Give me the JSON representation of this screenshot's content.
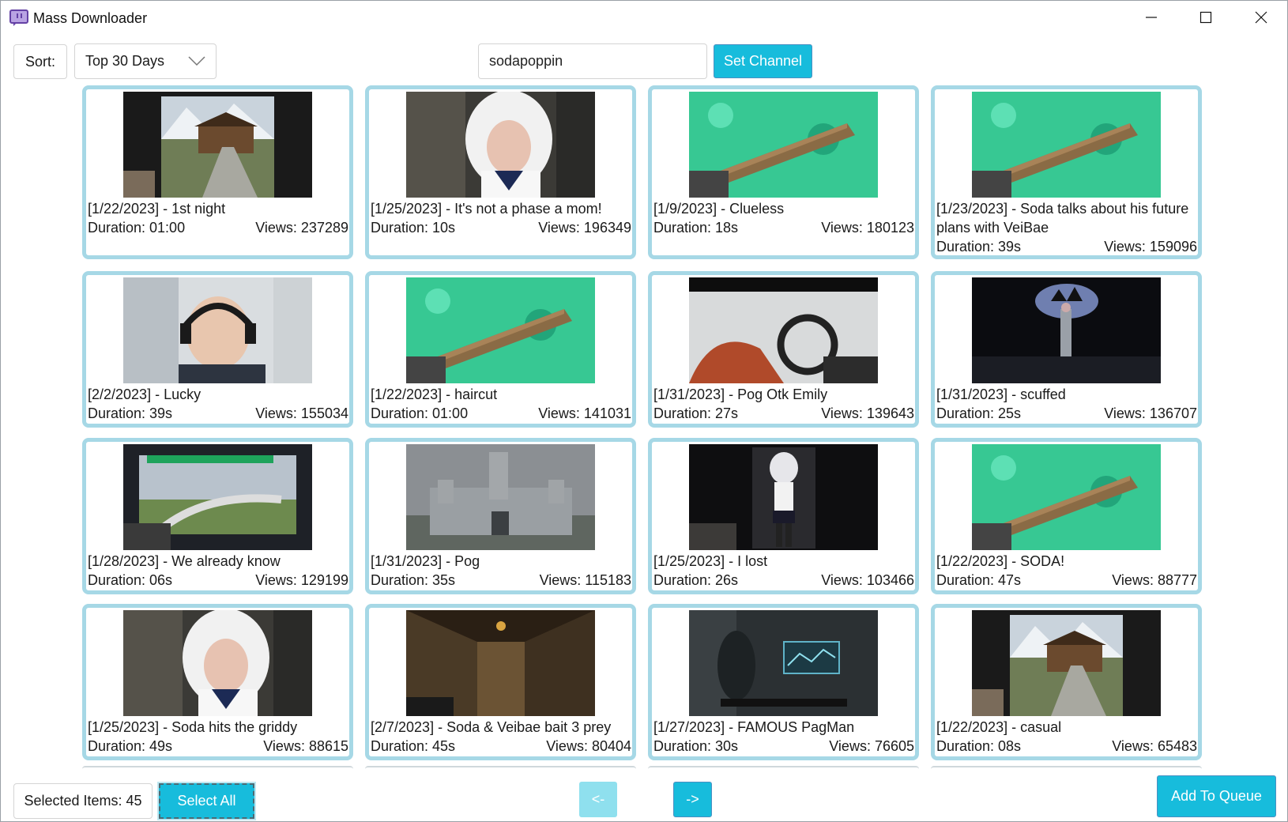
{
  "window": {
    "title": "Mass Downloader",
    "accent_color": "#17bcdc",
    "card_border_color": "#a6d8e6",
    "icon": "twitch-logo-icon"
  },
  "toolbar": {
    "sort_label": "Sort:",
    "sort_value": "Top 30 Days",
    "channel_value": "sodapoppin",
    "set_channel_label": "Set Channel"
  },
  "clips": [
    {
      "title": "[1/22/2023] - 1st night",
      "duration": "Duration: 01:00",
      "views": "Views: 237289",
      "thumb": "mountain-chalet"
    },
    {
      "title": "[1/25/2023] - It's not a phase a mom!",
      "duration": "Duration: 10s",
      "views": "Views: 196349",
      "thumb": "cosplay-streamer"
    },
    {
      "title": "[1/9/2023] - Clueless",
      "duration": "Duration: 18s",
      "views": "Views: 180123",
      "thumb": "water-dock"
    },
    {
      "title": "[1/23/2023] - Soda talks about his future plans with VeiBae",
      "duration": "Duration: 39s",
      "views": "Views: 159096",
      "thumb": "water-dock"
    },
    {
      "title": "[2/2/2023] - Lucky",
      "duration": "Duration: 39s",
      "views": "Views: 155034",
      "thumb": "headset-streamer"
    },
    {
      "title": "[1/22/2023] - haircut",
      "duration": "Duration: 01:00",
      "views": "Views: 141031",
      "thumb": "water-dock"
    },
    {
      "title": "[1/31/2023] - Pog Otk Emily",
      "duration": "Duration: 27s",
      "views": "Views: 139643",
      "thumb": "car-interior"
    },
    {
      "title": "[1/31/2023] - scuffed",
      "duration": "Duration: 25s",
      "views": "Views: 136707",
      "thumb": "dark-stage"
    },
    {
      "title": "[1/28/2023] - We already know",
      "duration": "Duration: 06s",
      "views": "Views: 129199",
      "thumb": "racing-game"
    },
    {
      "title": "[1/31/2023] - Pog",
      "duration": "Duration: 35s",
      "views": "Views: 115183",
      "thumb": "castle"
    },
    {
      "title": "[1/25/2023] - I lost",
      "duration": "Duration: 26s",
      "views": "Views: 103466",
      "thumb": "anime-avatar"
    },
    {
      "title": "[1/22/2023] - SODA!",
      "duration": "Duration: 47s",
      "views": "Views: 88777",
      "thumb": "water-dock"
    },
    {
      "title": "[1/25/2023] - Soda hits the griddy",
      "duration": "Duration: 49s",
      "views": "Views: 88615",
      "thumb": "cosplay-streamer"
    },
    {
      "title": "[2/7/2023] - Soda & Veibae bait 3 prey",
      "duration": "Duration: 45s",
      "views": "Views: 80404",
      "thumb": "dungeon"
    },
    {
      "title": "[1/27/2023] - FAMOUS PagMan",
      "duration": "Duration: 30s",
      "views": "Views: 76605",
      "thumb": "scifi-game"
    },
    {
      "title": "[1/22/2023] - casual",
      "duration": "Duration: 08s",
      "views": "Views: 65483",
      "thumb": "mountain-chalet"
    }
  ],
  "bottom": {
    "selected_label": "Selected Items: 45",
    "select_all_label": "Select All",
    "prev_label": "<-",
    "next_label": "->",
    "add_queue_label": "Add To Queue"
  }
}
